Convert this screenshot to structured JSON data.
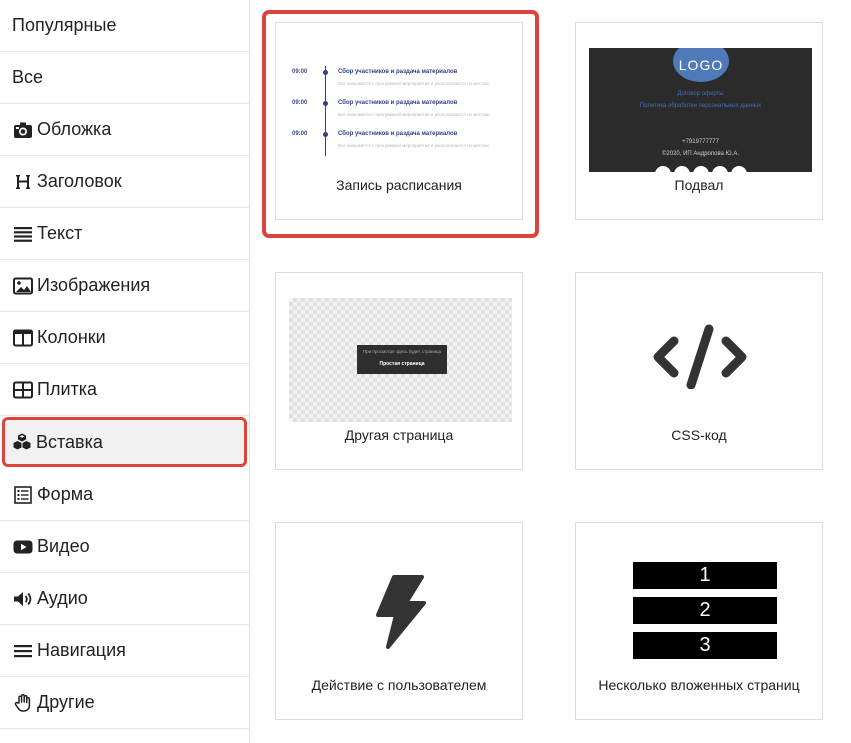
{
  "sidebar": {
    "items": [
      {
        "label": "Популярные"
      },
      {
        "label": "Все"
      },
      {
        "label": "Обложка"
      },
      {
        "label": "Заголовок"
      },
      {
        "label": "Текст"
      },
      {
        "label": "Изображения"
      },
      {
        "label": "Колонки"
      },
      {
        "label": "Плитка"
      },
      {
        "label": "Вставка"
      },
      {
        "label": "Форма"
      },
      {
        "label": "Видео"
      },
      {
        "label": "Аудио"
      },
      {
        "label": "Навигация"
      },
      {
        "label": "Другие"
      }
    ]
  },
  "cards": [
    {
      "label": "Запись расписания"
    },
    {
      "label": "Подвал"
    },
    {
      "label": "Другая страница"
    },
    {
      "label": "CSS-код"
    },
    {
      "label": "Действие с пользователем"
    },
    {
      "label": "Несколько вложенных страниц"
    }
  ],
  "schedule_preview": {
    "rows": [
      {
        "time": "09:00",
        "title": "Сбор участников и раздача материалов",
        "desc": "Все знакомятся с программой мероприятия и располагаются по местам"
      },
      {
        "time": "09:00",
        "title": "Сбор участников и раздача материалов",
        "desc": "Все знакомятся с программой мероприятия и располагаются по местам"
      },
      {
        "time": "09:00",
        "title": "Сбор участников и раздача материалов",
        "desc": "Все знакомятся с программой мероприятия и располагаются по местам"
      }
    ]
  },
  "footer_preview": {
    "logo": "LOGO",
    "link1": "Договор оферты",
    "link2": "Политика обработки персональных данных",
    "phone": "+7919777777",
    "copyright": "©2020, ИП Андропова Ю.А."
  },
  "other_page_preview": {
    "text": "При просмотре здесь будет страница",
    "title": "Простая страница"
  },
  "nested_preview": {
    "items": [
      "1",
      "2",
      "3"
    ]
  },
  "colors": {
    "accent": "#d9453b",
    "footer_bg": "#2b2b2b",
    "link": "#3f6fb3"
  }
}
